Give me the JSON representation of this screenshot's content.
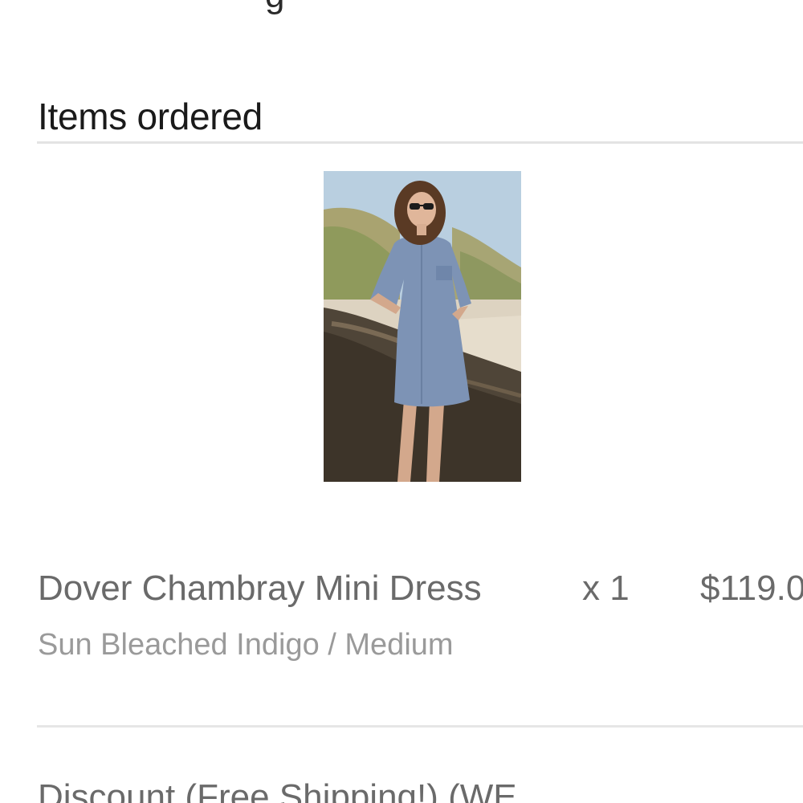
{
  "header": {
    "partial_text": "g"
  },
  "section": {
    "title": "Items ordered"
  },
  "items": [
    {
      "name": "Dover Chambray Mini Dress",
      "quantity": "x 1",
      "price": "$119.0",
      "variant": "Sun Bleached Indigo / Medium",
      "image_description_icon": "product-photo"
    }
  ],
  "discount": {
    "label": "Discount (Free Shipping!) (WE"
  },
  "colors": {
    "title_text": "#1a1a1a",
    "body_text": "#6a6a6a",
    "muted_text": "#9a9a9a",
    "divider": "#e3e3e3"
  }
}
